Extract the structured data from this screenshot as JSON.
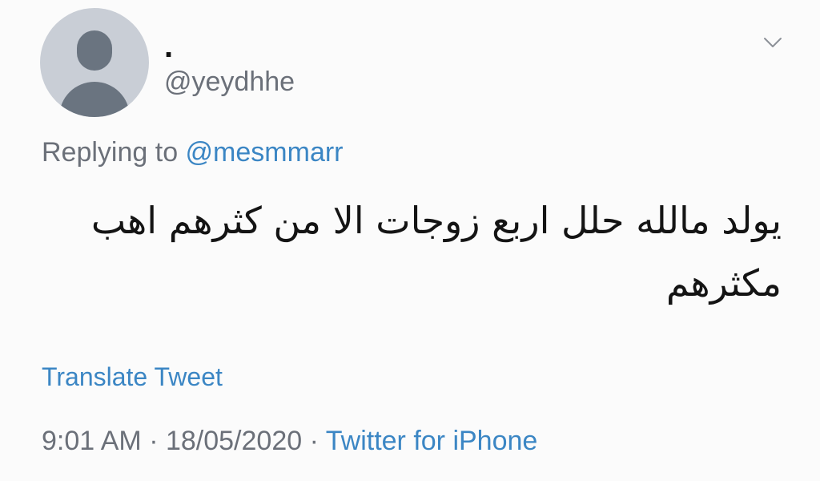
{
  "user": {
    "display_name": ".",
    "handle": "@yeydhhe"
  },
  "reply": {
    "prefix": "Replying to ",
    "mention": "@mesmmarr"
  },
  "tweet": {
    "text": "يولد مالله حلل اربع زوجات الا من كثرهم اهب مكثرهم"
  },
  "translate_label": "Translate Tweet",
  "meta": {
    "time": "9:01 AM",
    "separator_1": " · ",
    "date": "18/05/2020",
    "separator_2": " · ",
    "source": "Twitter for iPhone"
  },
  "icons": {
    "avatar": "default-avatar-icon",
    "menu": "chevron-down-icon"
  },
  "colors": {
    "link": "#3b86c4",
    "secondary_text": "#6b7079",
    "primary_text": "#141414"
  }
}
